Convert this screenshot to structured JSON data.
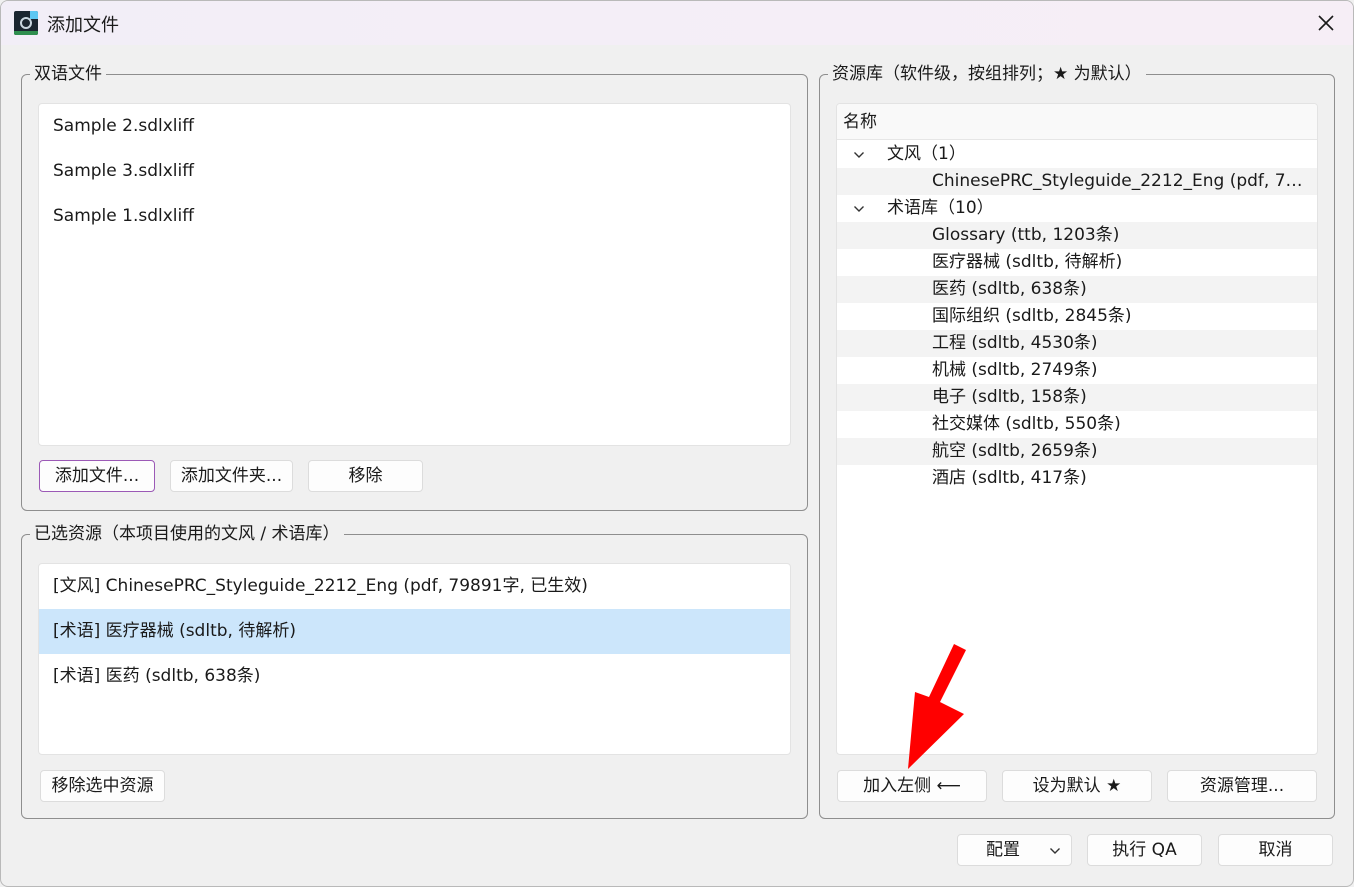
{
  "window": {
    "title": "添加文件"
  },
  "bilingual": {
    "group_label": "双语文件",
    "files": [
      "Sample 2.sdlxliff",
      "Sample 3.sdlxliff",
      "Sample 1.sdlxliff"
    ],
    "add_file_label": "添加文件...",
    "add_folder_label": "添加文件夹...",
    "remove_label": "移除"
  },
  "selected_resources": {
    "group_label": "已选资源（本项目使用的文风 / 术语库）",
    "items": [
      "[文风] ChinesePRC_Styleguide_2212_Eng (pdf, 79891字, 已生效)",
      "[术语] 医疗器械 (sdltb, 待解析)",
      "[术语] 医药 (sdltb, 638条)"
    ],
    "selected_index": 1,
    "remove_selected_label": "移除选中资源"
  },
  "library": {
    "group_label": "资源库（软件级，按组排列；★ 为默认）",
    "column_header": "名称",
    "groups": [
      {
        "label": "文风（1）",
        "items": [
          "ChinesePRC_Styleguide_2212_Eng (pdf, 79..."
        ]
      },
      {
        "label": "术语库（10）",
        "items": [
          "Glossary (ttb, 1203条)",
          "医疗器械 (sdltb, 待解析)",
          "医药 (sdltb, 638条)",
          "国际组织 (sdltb, 2845条)",
          "工程 (sdltb, 4530条)",
          "机械 (sdltb, 2749条)",
          "电子 (sdltb, 158条)",
          "社交媒体 (sdltb, 550条)",
          "航空 (sdltb, 2659条)",
          "酒店 (sdltb, 417条)"
        ]
      }
    ],
    "add_left_label": "加入左侧 ⟵",
    "set_default_label": "设为默认 ★",
    "manage_label": "资源管理..."
  },
  "footer": {
    "config_label": "配置",
    "run_qa_label": "执行 QA",
    "cancel_label": "取消"
  },
  "colors": {
    "selection": "#cce6fb",
    "focus_border": "#9b59b6",
    "annotation_arrow": "#ff0000"
  }
}
